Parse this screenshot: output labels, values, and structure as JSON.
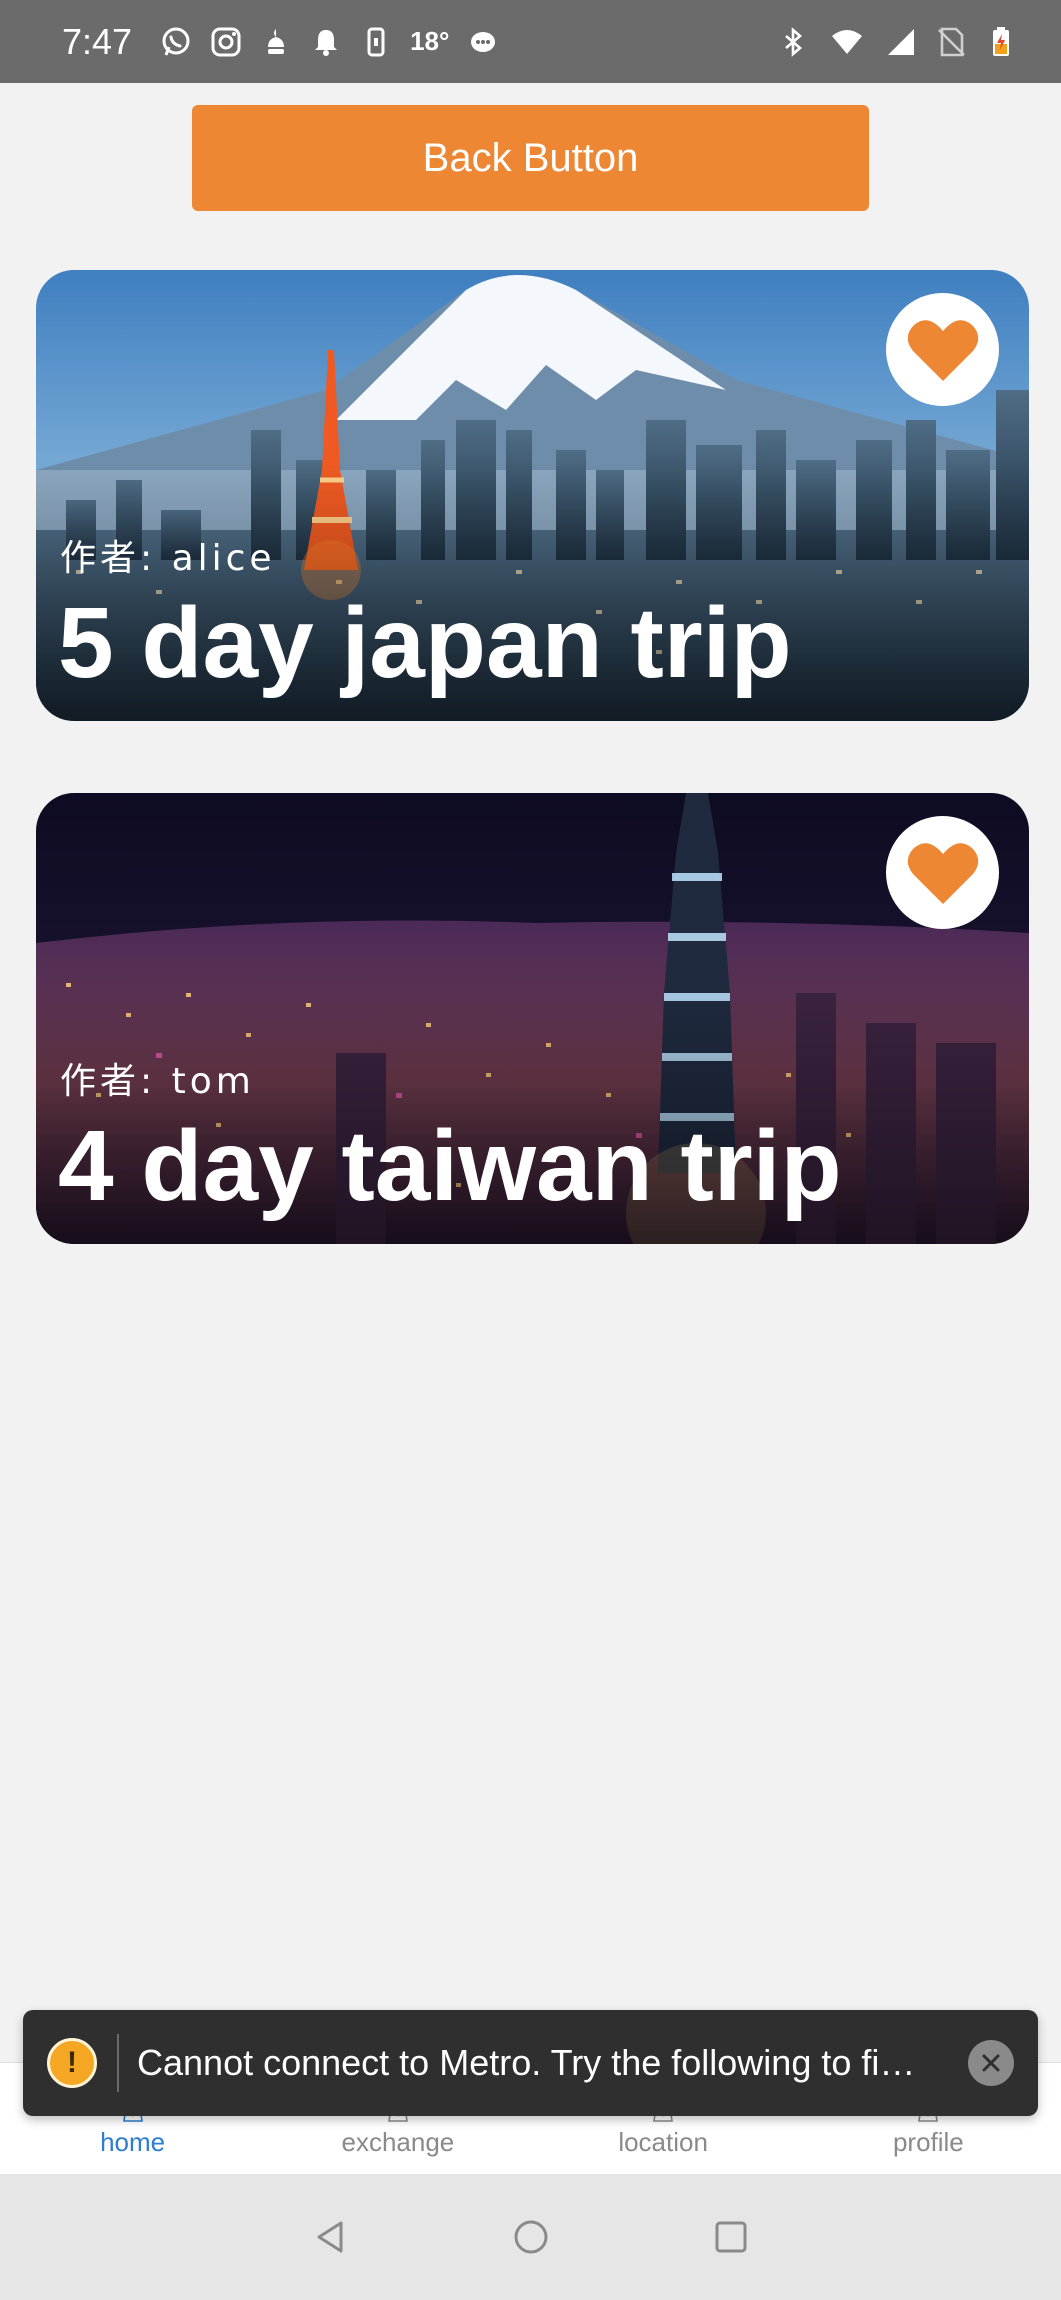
{
  "status_bar": {
    "time": "7:47",
    "temperature": "18°",
    "left_icons": [
      "whatsapp-icon",
      "instagram-icon",
      "app-icon",
      "notification-bell-icon",
      "phone-icon",
      "temperature-icon",
      "chat-icon"
    ],
    "right_icons": [
      "bluetooth-icon",
      "wifi-icon",
      "signal-icon",
      "no-sim-icon",
      "battery-charging-icon"
    ]
  },
  "back_button": {
    "label": "Back Button",
    "color": "#ee8733"
  },
  "trips": [
    {
      "author": "作者: alice",
      "title": "5 day japan trip",
      "favorited": true,
      "scene": "japan-city-mount-fuji"
    },
    {
      "author": "作者: tom",
      "title": "4 day taiwan trip",
      "favorited": true,
      "scene": "taipei-night-skyline"
    }
  ],
  "accent_color": "#ee8733",
  "tabs": [
    {
      "label": "home",
      "active": true
    },
    {
      "label": "exchange",
      "active": false
    },
    {
      "label": "location",
      "active": false
    },
    {
      "label": "profile",
      "active": false
    }
  ],
  "toast": {
    "message": "Cannot connect to Metro.  Try the following to fi…",
    "icon": "warning-icon"
  }
}
